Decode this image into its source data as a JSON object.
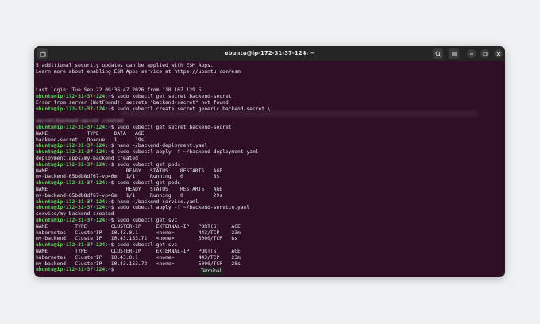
{
  "window": {
    "title": "ubuntu@ip-172-31-37-124: ~"
  },
  "tooltip": "Terminal",
  "prompt_user": "ubuntu@ip-172-31-37-124",
  "prompt_path": "~",
  "lines": [
    {
      "type": "out",
      "text": "5 additional security updates can be applied with ESM Apps."
    },
    {
      "type": "out",
      "text": "Learn more about enabling ESM Apps service at https://ubuntu.com/esm"
    },
    {
      "type": "out",
      "text": ""
    },
    {
      "type": "out",
      "text": ""
    },
    {
      "type": "out",
      "text": "Last login: Tue Sep 22 09:36:47 2026 from 118.107.129.5"
    },
    {
      "type": "cmd",
      "text": "sudo kubectl get secret backend-secret"
    },
    {
      "type": "out",
      "text": "Error from server (NotFound): secrets \"backend-secret\" not found"
    },
    {
      "type": "cmd",
      "text": "sudo kubectl create secret generic backend-secret \\"
    },
    {
      "type": "blur",
      "text": ""
    },
    {
      "type": "blur",
      "text": "secret/backend-secret created"
    },
    {
      "type": "cmd",
      "text": "sudo kubectl get secret backend-secret"
    },
    {
      "type": "out",
      "text": "NAME             TYPE     DATA   AGE"
    },
    {
      "type": "out",
      "text": "backend-secret   Opaque   1      19s"
    },
    {
      "type": "cmd",
      "text": "nano ~/backend-deployment.yaml"
    },
    {
      "type": "cmd",
      "text": "sudo kubectl apply -f ~/backend-deployment.yaml"
    },
    {
      "type": "out",
      "text": "deployment.apps/my-backend created"
    },
    {
      "type": "cmd",
      "text": "sudo kubectl get pods"
    },
    {
      "type": "out",
      "text": "NAME                          READY   STATUS    RESTARTS   AGE"
    },
    {
      "type": "out",
      "text": "my-backend-65bdb8df67-vp46m   1/1     Running   0          8s"
    },
    {
      "type": "cmd",
      "text": "sudo kubectl get pods"
    },
    {
      "type": "out",
      "text": "NAME                          READY   STATUS    RESTARTS   AGE"
    },
    {
      "type": "out",
      "text": "my-backend-65bdb8df67-vp46m   1/1     Running   0          29s"
    },
    {
      "type": "cmd",
      "text": "nano ~/backend-service.yaml"
    },
    {
      "type": "cmd",
      "text": "sudo kubectl apply -f ~/backend-service.yaml"
    },
    {
      "type": "out",
      "text": "service/my-backend created"
    },
    {
      "type": "cmd",
      "text": "sudo kubectl get svc"
    },
    {
      "type": "out",
      "text": "NAME         TYPE        CLUSTER-IP     EXTERNAL-IP   PORT(S)    AGE"
    },
    {
      "type": "out",
      "text": "kubernetes   ClusterIP   10.43.0.1      <none>        443/TCP    23m"
    },
    {
      "type": "out",
      "text": "my-backend   ClusterIP   10.43.153.72   <none>        5000/TCP   8s"
    },
    {
      "type": "cmd",
      "text": "sudo kubectl get svc"
    },
    {
      "type": "out",
      "text": "NAME         TYPE        CLUSTER-IP     EXTERNAL-IP   PORT(S)    AGE"
    },
    {
      "type": "out",
      "text": "kubernetes   ClusterIP   10.43.0.1      <none>        443/TCP    23m"
    },
    {
      "type": "out",
      "text": "my-backend   ClusterIP   10.43.153.72   <none>        5000/TCP   28s"
    },
    {
      "type": "cmd",
      "text": ""
    }
  ],
  "icons": [
    "new-tab-icon",
    "search-icon",
    "hamburger-menu-icon",
    "minimize-icon",
    "maximize-icon",
    "close-icon"
  ]
}
